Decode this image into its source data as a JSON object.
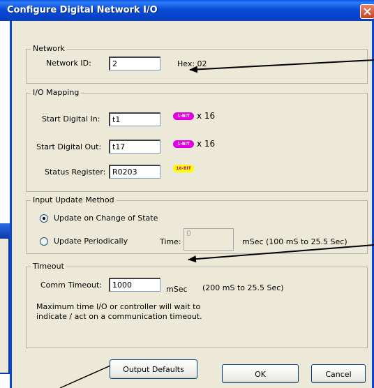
{
  "window": {
    "title": "Configure Digital Network I/O"
  },
  "network": {
    "legend": "Network",
    "id_label": "Network ID:",
    "id_value": "2",
    "hex_text": "Hex: 02"
  },
  "io_mapping": {
    "legend": "I/O Mapping",
    "start_in_label": "Start Digital In:",
    "start_in_value": "t1",
    "start_in_badge": "1-BIT",
    "start_in_count": "x 16",
    "start_out_label": "Start Digital Out:",
    "start_out_value": "t17",
    "start_out_badge": "1-BIT",
    "start_out_count": "x 16",
    "status_label": "Status Register:",
    "status_value": "R0203",
    "status_badge": "16-BIT"
  },
  "input_update": {
    "legend": "Input Update Method",
    "option_change": "Update on Change of State",
    "option_periodic": "Update Periodically",
    "selected": "Update on Change of State",
    "time_label": "Time:",
    "time_value": "0",
    "time_unit": "mSec (100 mS to 25.5 Sec)"
  },
  "timeout": {
    "legend": "Timeout",
    "comm_label": "Comm Timeout:",
    "comm_value": "1000",
    "unit": "mSec",
    "range": "(200 mS to 25.5 Sec)",
    "description_line1": "Maximum time I/O or controller will wait to",
    "description_line2": "indicate / act on a communication timeout."
  },
  "buttons": {
    "output_defaults": "Output Defaults",
    "ok": "OK",
    "cancel": "Cancel"
  },
  "colors": {
    "title_bar": "#0A4BD6",
    "dialog_bg": "#ECE9D8",
    "bit_badge": "#E000E0",
    "word_badge": "#FFFF00"
  }
}
